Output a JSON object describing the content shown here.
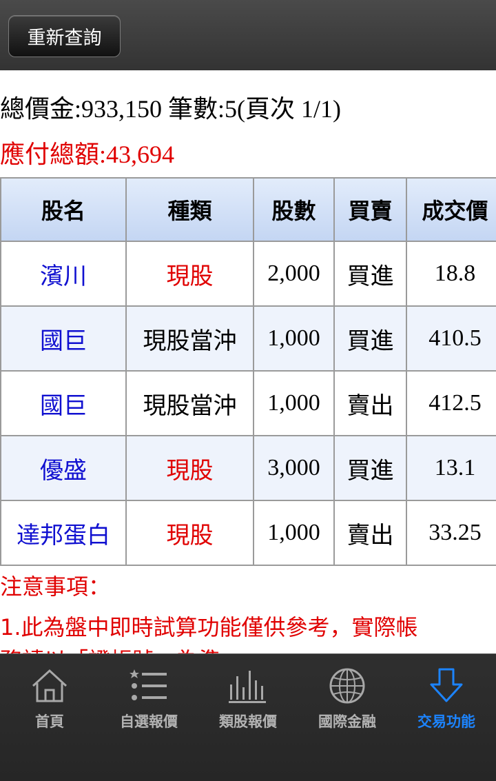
{
  "header": {
    "requery_label": "重新查詢"
  },
  "summary": {
    "total_line": "總價金:933,150 筆數:5(頁次 1/1)",
    "payable_line": "應付總額:43,694"
  },
  "table": {
    "headers": [
      "股名",
      "種類",
      "股數",
      "買賣",
      "成交價"
    ],
    "rows": [
      {
        "name": "濱川",
        "type": "現股",
        "shares": "2,000",
        "side": "買進",
        "price": "18.8"
      },
      {
        "name": "國巨",
        "type": "現股當沖",
        "shares": "1,000",
        "side": "買進",
        "price": "410.5"
      },
      {
        "name": "國巨",
        "type": "現股當沖",
        "shares": "1,000",
        "side": "賣出",
        "price": "412.5"
      },
      {
        "name": "優盛",
        "type": "現股",
        "shares": "3,000",
        "side": "買進",
        "price": "13.1"
      },
      {
        "name": "達邦蛋白",
        "type": "現股",
        "shares": "1,000",
        "side": "賣出",
        "price": "33.25"
      }
    ]
  },
  "notice": {
    "title": "注意事項：",
    "line1": "1.此為盤中即時試算功能僅供參考，實際帳",
    "line2": "務請以「證帳號」為準"
  },
  "tabs": [
    {
      "label": "首頁",
      "icon": "home-icon"
    },
    {
      "label": "自選報價",
      "icon": "starred-list-icon"
    },
    {
      "label": "類股報價",
      "icon": "bar-chart-icon"
    },
    {
      "label": "國際金融",
      "icon": "globe-icon"
    },
    {
      "label": "交易功能",
      "icon": "download-arrow-icon",
      "active": true
    }
  ],
  "colors": {
    "accent": "#1c84ff",
    "alert": "#e00000",
    "stock_name": "#1010d0",
    "header_bg": "#c4d6f3"
  }
}
